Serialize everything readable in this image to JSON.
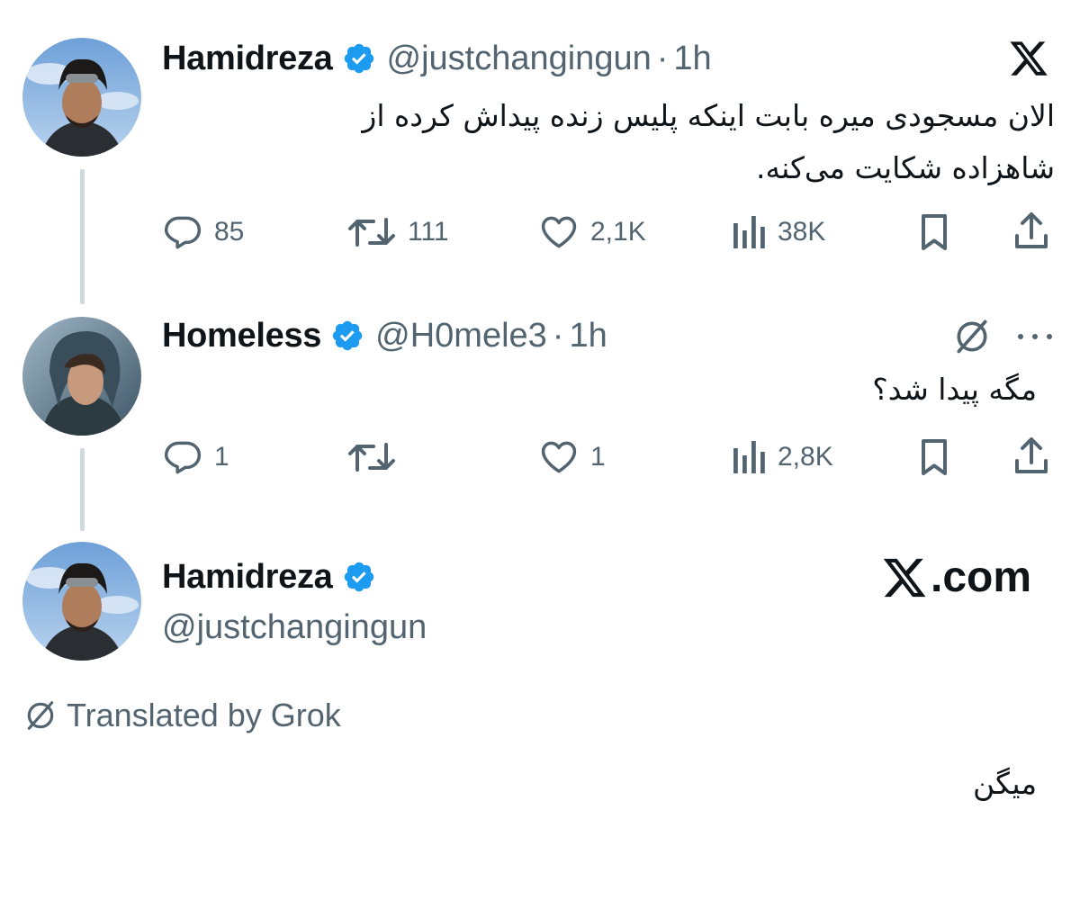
{
  "tweet1": {
    "name": "Hamidreza",
    "handle": "@justchangingun",
    "separator": "·",
    "time": "1h",
    "text_line1": "الان مسجودی میره بابت اینکه پلیس زنده پیداش کرده از",
    "text_line2": "شاهزاده شکایت می‌کنه.",
    "replies": "85",
    "reposts": "111",
    "likes": "2,1K",
    "views": "38K"
  },
  "tweet2": {
    "name": "Homeless",
    "handle": "@H0mele3",
    "separator": "·",
    "time": "1h",
    "text": "مگه پیدا شد؟",
    "replies": "1",
    "reposts": "",
    "likes": "1",
    "views": "2,8K"
  },
  "tweet3": {
    "name": "Hamidreza",
    "handle": "@justchangingun",
    "brand": ".com",
    "translated_label": "Translated by Grok",
    "text": "میگن"
  },
  "icons": {
    "reply": "reply-icon",
    "repost": "repost-icon",
    "like": "heart-icon",
    "views": "views-icon",
    "bookmark": "bookmark-icon",
    "share": "share-icon",
    "verified": "verified-badge-icon",
    "grok": "grok-icon",
    "more": "more-icon",
    "x_logo": "x-logo-icon"
  },
  "colors": {
    "verified_blue": "#1d9bf0",
    "secondary_text": "#536471",
    "primary_text": "#0f1419",
    "thread_line": "#cfd9de"
  }
}
